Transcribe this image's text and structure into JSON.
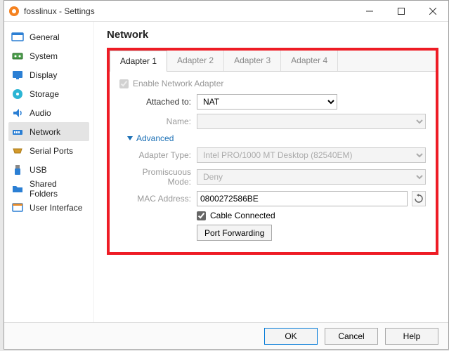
{
  "window": {
    "title": "fosslinux - Settings"
  },
  "sidebar": {
    "items": [
      {
        "label": "General"
      },
      {
        "label": "System"
      },
      {
        "label": "Display"
      },
      {
        "label": "Storage"
      },
      {
        "label": "Audio"
      },
      {
        "label": "Network"
      },
      {
        "label": "Serial Ports"
      },
      {
        "label": "USB"
      },
      {
        "label": "Shared Folders"
      },
      {
        "label": "User Interface"
      }
    ]
  },
  "main": {
    "heading": "Network",
    "tabs": [
      "Adapter 1",
      "Adapter 2",
      "Adapter 3",
      "Adapter 4"
    ],
    "enable_label": "Enable Network Adapter",
    "attached_label": "Attached to:",
    "attached_value": "NAT",
    "name_label": "Name:",
    "name_value": "",
    "advanced_label": "Advanced",
    "adapter_type_label": "Adapter Type:",
    "adapter_type_value": "Intel PRO/1000 MT Desktop (82540EM)",
    "promiscuous_label": "Promiscuous Mode:",
    "promiscuous_value": "Deny",
    "mac_label": "MAC Address:",
    "mac_value": "0800272586BE",
    "cable_label": "Cable Connected",
    "port_forwarding": "Port Forwarding"
  },
  "footer": {
    "ok": "OK",
    "cancel": "Cancel",
    "help": "Help"
  }
}
